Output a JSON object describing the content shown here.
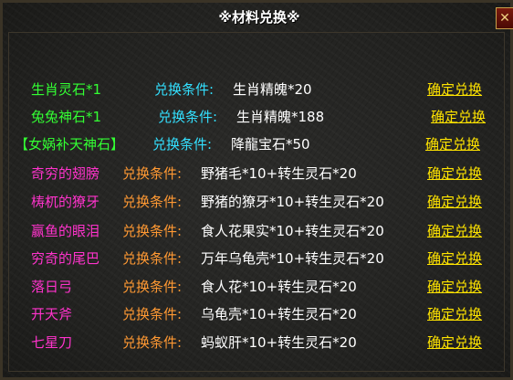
{
  "window": {
    "title": "※材料兑换※"
  },
  "colors": {
    "green": "#33ff33",
    "cyan": "#33e0ff",
    "orange": "#ff9933",
    "magenta": "#ff33cc",
    "yellow": "#ffe400",
    "white": "#ffffff"
  },
  "rows": [
    {
      "name": "生肖灵石*1",
      "cond_label": "兑换条件:",
      "cond_value": "生肖精魄*20",
      "action": "确定兑换"
    },
    {
      "name": "兔兔神石*1",
      "cond_label": "兑换条件:",
      "cond_value": "生肖精魄*188",
      "action": "确定兑换"
    },
    {
      "name": "【女娲补天神石】",
      "cond_label": "兑换条件:",
      "cond_value": "降龍宝石*50",
      "action": "确定兑换"
    },
    {
      "name": "奇穷的翅膀",
      "cond_label": "兑换条件:",
      "cond_value": "野猪毛*10+转生灵石*20",
      "action": "确定兑换"
    },
    {
      "name": "梼杌的獠牙",
      "cond_label": "兑换条件:",
      "cond_value": "野猪的獠牙*10+转生灵石*20",
      "action": "确定兑换"
    },
    {
      "name": "赢鱼的眼泪",
      "cond_label": "兑换条件:",
      "cond_value": "食人花果实*10+转生灵石*20",
      "action": "确定兑换"
    },
    {
      "name": "穷奇的尾巴",
      "cond_label": "兑换条件:",
      "cond_value": "万年乌龟壳*10+转生灵石*20",
      "action": "确定兑换"
    },
    {
      "name": "落日弓",
      "cond_label": "兑换条件:",
      "cond_value": "食人花*10+转生灵石*20",
      "action": "确定兑换"
    },
    {
      "name": "开天斧",
      "cond_label": "兑换条件:",
      "cond_value": "乌龟壳*10+转生灵石*20",
      "action": "确定兑换"
    },
    {
      "name": "七星刀",
      "cond_label": "兑换条件:",
      "cond_value": "蚂蚁肝*10+转生灵石*20",
      "action": "确定兑换"
    }
  ]
}
